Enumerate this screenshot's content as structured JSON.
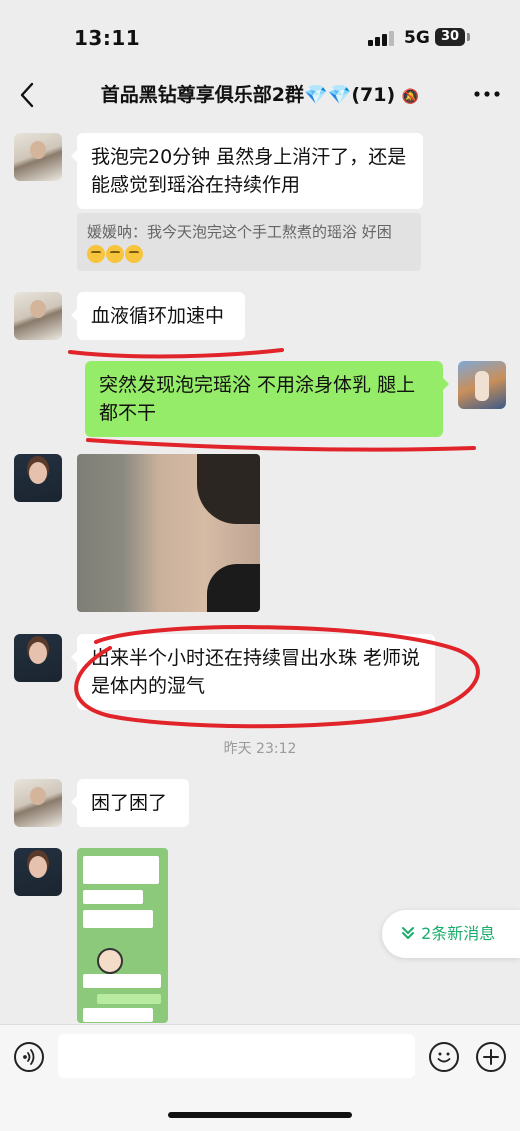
{
  "status_bar": {
    "time": "13:11",
    "network": "5G",
    "battery": "30"
  },
  "header": {
    "title": "首品黑钻尊享俱乐部2群",
    "gems": "💎💎",
    "member_count": "(71)",
    "mute_icon": "bell-off-icon"
  },
  "messages": [
    {
      "sender": "a",
      "text": "我泡完20分钟 虽然身上消汗了，还是能感觉到瑶浴在持续作用",
      "quote": "媛媛呐：我今天泡完这个手工熬煮的瑶浴 好困"
    },
    {
      "sender": "a",
      "text": "血液循环加速中"
    },
    {
      "sender": "me",
      "text": "突然发现泡完瑶浴 不用涂身体乳 腿上都不干"
    },
    {
      "sender": "b",
      "type": "image"
    },
    {
      "sender": "b",
      "text": "出来半个小时还在持续冒出水珠  老师说是体内的湿气"
    },
    {
      "type": "timestamp",
      "text": "昨天 23:12"
    },
    {
      "sender": "a",
      "text": "困了困了"
    },
    {
      "sender": "b",
      "type": "image"
    }
  ],
  "new_messages_pill": {
    "label": "2条新消息",
    "icon": "double-chevron-down-icon"
  },
  "input_bar": {
    "voice_icon": "voice-icon",
    "emoji_icon": "emoji-icon",
    "plus_icon": "plus-icon"
  },
  "colors": {
    "my_bubble": "#95ec69",
    "accent_green": "#1aad6b",
    "annotation_red": "#e0242a"
  }
}
